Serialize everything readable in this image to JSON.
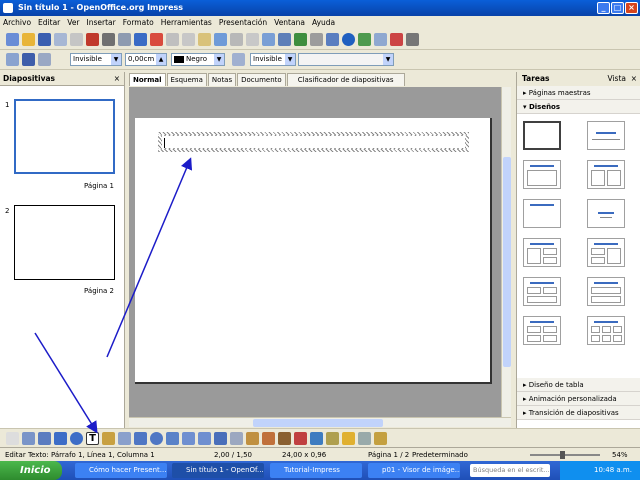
{
  "window": {
    "title": "Sin título 1 - OpenOffice.org Impress"
  },
  "menu": [
    "Archivo",
    "Editar",
    "Ver",
    "Insertar",
    "Formato",
    "Herramientas",
    "Presentación",
    "Ventana",
    "Ayuda"
  ],
  "format_toolbar": {
    "line_style": "Invisible",
    "line_width": "0,00cm",
    "line_color": "Negro",
    "area_style": "Invisible"
  },
  "slides_panel": {
    "title": "Diapositivas",
    "slides": [
      {
        "number": "1",
        "label": "Página 1"
      },
      {
        "number": "2",
        "label": "Página 2"
      }
    ]
  },
  "view_tabs": [
    "Normal",
    "Esquema",
    "Notas",
    "Documento",
    "Clasificador de diapositivas"
  ],
  "tasks_panel": {
    "title": "Tareas",
    "view_label": "Vista",
    "sections": {
      "master_pages": "Páginas maestras",
      "layouts": "Diseños",
      "table_design": "Diseño de tabla",
      "custom_animation": "Animación personalizada",
      "slide_transition": "Transición de diapositivas"
    }
  },
  "statusbar": {
    "edit_text": "Editar Texto: Párrafo 1, Línea 1, Columna 1",
    "position": "2,00 / 1,50",
    "size": "24,00 x 0,96",
    "page": "Página 1 / 2",
    "style": "Predeterminado",
    "zoom": "54%"
  },
  "taskbar": {
    "start_label": "Inicio",
    "items": [
      "Cómo hacer Present...",
      "Sin título 1 - OpenOf...",
      "Tutorial-Impress",
      "p01 - Visor de imáge..."
    ],
    "search_placeholder": "Búsqueda en el escrit...",
    "clock": "10:48 a.m."
  },
  "colors": {
    "xp_title_blue": "#0842A8",
    "selection_blue": "#316AC5",
    "arrow_blue": "#1C1CC8"
  }
}
